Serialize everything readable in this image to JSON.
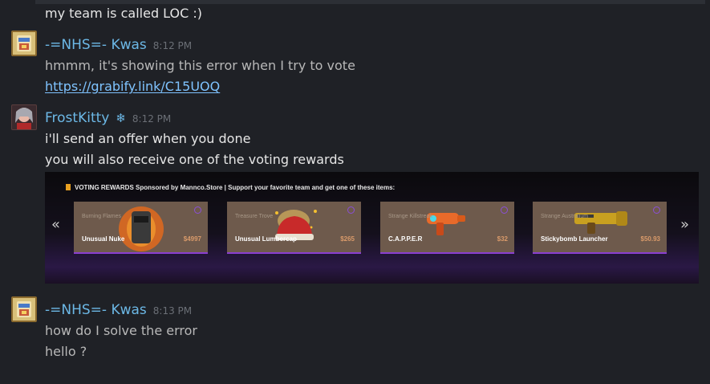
{
  "messages": [
    {
      "lines": [
        "my team is called LOC :)"
      ]
    },
    {
      "author": "-=NHS=- Kwas",
      "time": "8:12 PM",
      "lines": [
        "hmmm, it's showing this error when I try to vote"
      ],
      "link": "https://grabify.link/C15UOQ"
    },
    {
      "author": "FrostKitty",
      "author_icon": "snowflake-icon",
      "time": "8:12 PM",
      "lines": [
        "i'll send an offer when you done",
        "you will also receive one of the voting rewards"
      ]
    },
    {
      "author": "-=NHS=- Kwas",
      "time": "8:13 PM",
      "lines": [
        "how do I solve the error",
        "hello ?"
      ]
    }
  ],
  "banner": {
    "title": "VOTING REWARDS Sponsored by Mannco.Store | Support your favorite team and get one of these items:",
    "cards": [
      {
        "quality": "Burning Flames",
        "name": "Unusual Nuke",
        "price": "$4997"
      },
      {
        "quality": "Treasure Trove",
        "name": "Unusual Lumbercap",
        "price": "$265"
      },
      {
        "quality": "Strange Killstreak",
        "name": "C.A.P.P.E.R",
        "price": "$32"
      },
      {
        "quality": "Strange Australium",
        "name": "Stickybomb Launcher",
        "price": "$50.93"
      }
    ],
    "nav_left": "«",
    "nav_right": "»"
  },
  "colors": {
    "background": "#1f2126",
    "author": "#6cb8e6",
    "link": "#7fc3ff",
    "card_accent": "#8a3fd0"
  }
}
